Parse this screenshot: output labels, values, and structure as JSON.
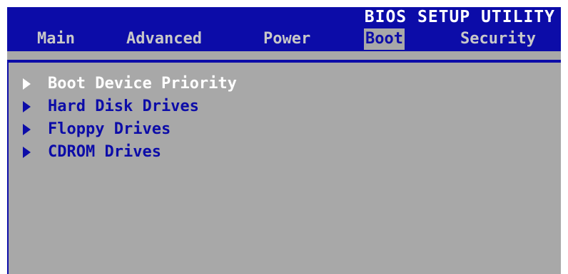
{
  "header": {
    "title": "BIOS SETUP UTILITY"
  },
  "tabs": [
    {
      "label": "Main",
      "active": false
    },
    {
      "label": "Advanced",
      "active": false
    },
    {
      "label": "Power",
      "active": false
    },
    {
      "label": "Boot",
      "active": true
    },
    {
      "label": "Security",
      "active": false
    }
  ],
  "menu": {
    "items": [
      {
        "label": "Boot Device Priority",
        "icon": "triangle-right-icon",
        "selected": true
      },
      {
        "label": "Hard Disk Drives",
        "icon": "triangle-right-icon",
        "selected": false
      },
      {
        "label": "Floppy Drives",
        "icon": "triangle-right-icon",
        "selected": false
      },
      {
        "label": "CDROM Drives",
        "icon": "triangle-right-icon",
        "selected": false
      }
    ]
  },
  "colors": {
    "bios_blue": "#0c0ca8",
    "panel_gray": "#a8a8a8",
    "tab_text": "#c8c8c8",
    "highlight_text": "#ffffff"
  }
}
